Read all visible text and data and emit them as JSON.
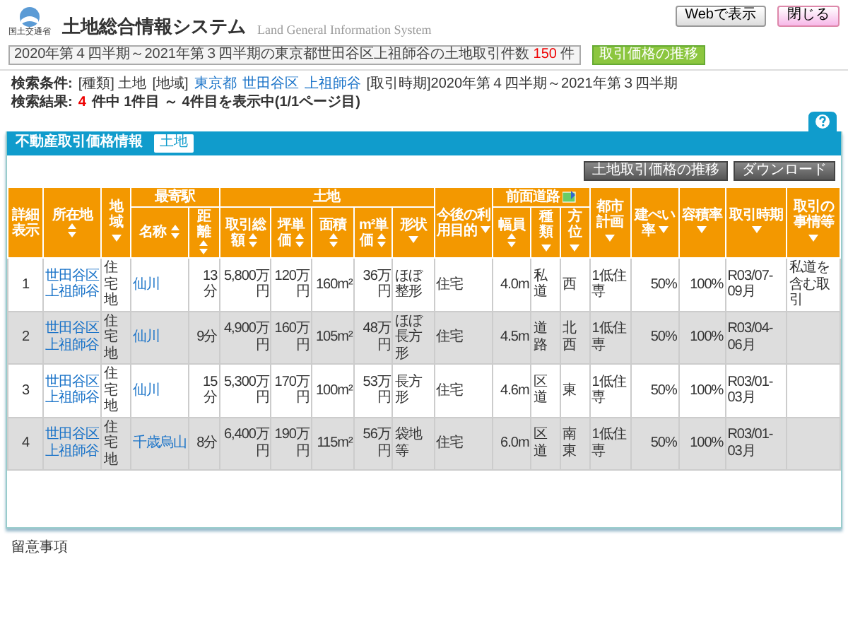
{
  "header": {
    "logo_caption": "国土交通省",
    "title": "土地総合情報システム",
    "subtitle": "Land General Information System",
    "notice": {
      "text": "2020年第４四半期～2021年第３四半期の東京都世田谷区上祖師谷の土地取引件数",
      "count": "150",
      "unit": "件"
    },
    "trend_button": "取引価格の推移",
    "buttons": [
      {
        "label": "Webで表示",
        "kind": "plain"
      },
      {
        "label": "閉じる",
        "kind": "pink"
      }
    ]
  },
  "conditions": {
    "label": "検索条件:",
    "items": [
      {
        "text": "[種類] 土地",
        "link": false
      },
      {
        "text": "[地域]",
        "link": false
      },
      {
        "text": "東京都",
        "link": true
      },
      {
        "text": "世田谷区",
        "link": true
      },
      {
        "text": "上祖師谷",
        "link": true
      },
      {
        "text": "[取引時期]2020年第４四半期～2021年第３四半期",
        "link": false
      }
    ]
  },
  "results": {
    "label": "検索結果:",
    "count": "4",
    "rest": "件中 1件目 ～ 4件目を表示中(1/1ページ目)"
  },
  "panel": {
    "title": "不動産取引価格情報",
    "tab": "土地",
    "buttons": [
      "土地取引価格の推移",
      "ダウンロード"
    ],
    "columns": [
      {
        "label": "詳細表示",
        "kind": "plain"
      },
      {
        "label": "所在地",
        "kind": "sort"
      },
      {
        "label": "地域",
        "kind": "filter"
      },
      {
        "label": "最寄駅",
        "kind": "plain",
        "colspan": 2,
        "children": [
          {
            "label": "名称",
            "kind": "sort"
          },
          {
            "label": "距離",
            "kind": "sort"
          }
        ]
      },
      {
        "label": "土地",
        "kind": "plain",
        "colspan": 5,
        "children": [
          {
            "label": "取引総額",
            "kind": "sort"
          },
          {
            "label": "坪単価",
            "kind": "sort"
          },
          {
            "label": "面積",
            "kind": "sort"
          },
          {
            "label": "m²単価",
            "kind": "sort"
          },
          {
            "label": "形状",
            "kind": "filter"
          }
        ]
      },
      {
        "label": "今後の利用目的",
        "kind": "filter"
      },
      {
        "label": "前面道路",
        "kind": "map",
        "colspan": 3,
        "children": [
          {
            "label": "幅員",
            "kind": "sort"
          },
          {
            "label": "種類",
            "kind": "filter"
          },
          {
            "label": "方位",
            "kind": "filter"
          }
        ]
      },
      {
        "label": "都市計画",
        "kind": "filter"
      },
      {
        "label": "建ぺい率",
        "kind": "filter"
      },
      {
        "label": "容積率",
        "kind": "filter"
      },
      {
        "label": "取引時期",
        "kind": "filter"
      },
      {
        "label": "取引の事情等",
        "kind": "filter"
      }
    ],
    "rows": [
      {
        "cells": [
          "1",
          [
            "世田谷区",
            "上祖師谷"
          ],
          "住宅地",
          "仙川",
          "13分",
          "5,800万円",
          "120万円",
          "160m²",
          "36万円",
          "ほぼ整形",
          "住宅",
          "4.0m",
          "私道",
          "西",
          "1低住専",
          "50%",
          "100%",
          "R03/07-09月",
          "私道を含む取引"
        ]
      },
      {
        "cells": [
          "2",
          [
            "世田谷区",
            "上祖師谷"
          ],
          "住宅地",
          "仙川",
          "9分",
          "4,900万円",
          "160万円",
          "105m²",
          "48万円",
          "ほぼ長方形",
          "住宅",
          "4.5m",
          "道路",
          "北西",
          "1低住専",
          "50%",
          "100%",
          "R03/04-06月",
          ""
        ]
      },
      {
        "cells": [
          "3",
          [
            "世田谷区",
            "上祖師谷"
          ],
          "住宅地",
          "仙川",
          "15分",
          "5,300万円",
          "170万円",
          "100m²",
          "53万円",
          "長方形",
          "住宅",
          "4.6m",
          "区道",
          "東",
          "1低住専",
          "50%",
          "100%",
          "R03/01-03月",
          ""
        ]
      },
      {
        "cells": [
          "4",
          [
            "世田谷区",
            "上祖師谷"
          ],
          "住宅地",
          "千歳烏山",
          "8分",
          "6,400万円",
          "190万円",
          "115m²",
          "56万円",
          "袋地等",
          "住宅",
          "6.0m",
          "区道",
          "南東",
          "1低住専",
          "50%",
          "100%",
          "R03/01-03月",
          ""
        ]
      }
    ]
  },
  "footer": "留意事項"
}
